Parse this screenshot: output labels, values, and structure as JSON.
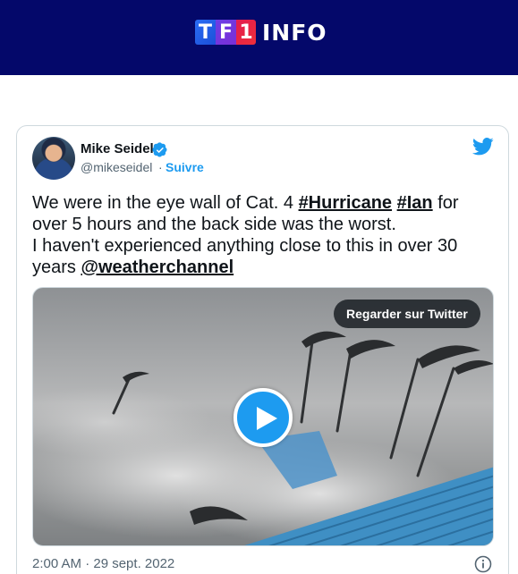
{
  "header": {
    "logo_tf1": [
      "T",
      "F",
      "1"
    ],
    "logo_info": "INFO",
    "background_color": "#04086a"
  },
  "tweet": {
    "author_name": "Mike Seidel",
    "author_handle": "@mikeseidel",
    "separator": "·",
    "follow_label": "Suivre",
    "verified_icon": "verified-badge-icon",
    "brand_icon": "twitter-bird-icon",
    "accent_color": "#1d9bf0",
    "text": {
      "line1_prefix": "We were in the eye wall of Cat. 4 ",
      "hashtag1": "#Hurricane",
      "hashtag2": "#Ian",
      "line1_suffix": " for",
      "line2": "over 5 hours and the back side was the worst.",
      "line3": "I haven't experienced anything close to this in over 30",
      "line4_prefix": "years ",
      "mention": "@weatherchannel"
    },
    "media": {
      "watch_label": "Regarder sur Twitter",
      "play_icon": "play-icon"
    },
    "timestamp": "2:00 AM · 29 sept. 2022",
    "info_icon": "info-icon"
  }
}
